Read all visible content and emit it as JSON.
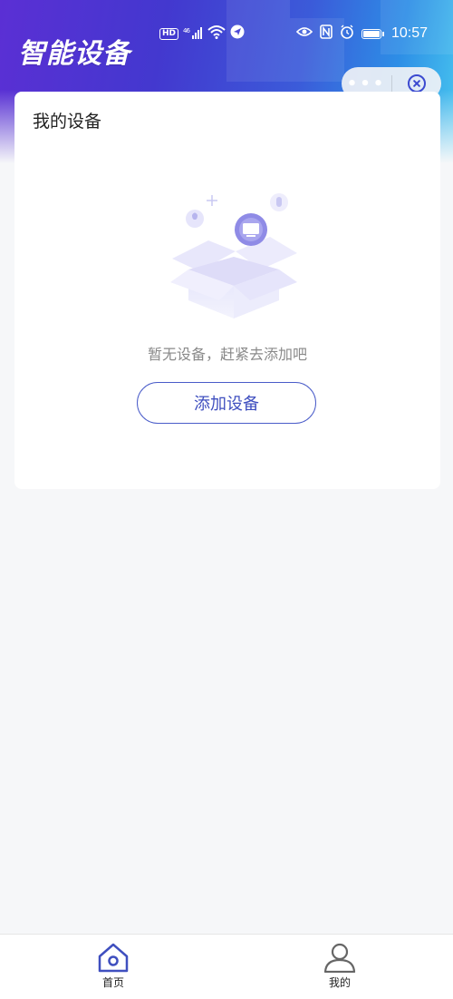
{
  "status_bar": {
    "hd": "HD",
    "signal": "4G",
    "time": "10:57"
  },
  "header": {
    "title": "智能设备"
  },
  "capsule": {
    "more_label": "•••"
  },
  "devices_card": {
    "title": "我的设备",
    "empty_text": "暂无设备，赶紧去添加吧",
    "add_button_label": "添加设备"
  },
  "tabbar": {
    "items": [
      {
        "label": "首页",
        "icon": "home-icon",
        "active": true
      },
      {
        "label": "我的",
        "icon": "user-icon",
        "active": false
      }
    ]
  },
  "colors": {
    "accent": "#3f4fbf",
    "page_bg": "#f6f7f9",
    "header_start": "#5b2fd4",
    "header_end": "#48c6ef"
  }
}
